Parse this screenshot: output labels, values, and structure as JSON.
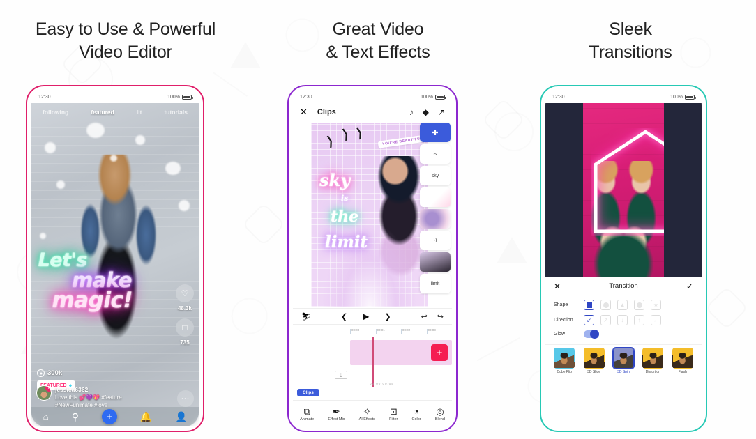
{
  "panels": [
    {
      "heading_line1": "Easy to Use & Powerful",
      "heading_line2": "Video Editor",
      "frame_color": "#e01f6a"
    },
    {
      "heading_line1": "Great Video",
      "heading_line2": "& Text Effects",
      "frame_color": "#8c27cf"
    },
    {
      "heading_line1": "Sleek",
      "heading_line2": "Transitions",
      "frame_color": "#27c9b5"
    }
  ],
  "status_bar": {
    "time": "12:30",
    "battery": "100%"
  },
  "phone1": {
    "tabs": [
      {
        "label": "following",
        "active": false
      },
      {
        "label": "featured",
        "active": true
      },
      {
        "label": "lit",
        "active": false
      },
      {
        "label": "tutorials",
        "active": false
      }
    ],
    "neon_text": {
      "line1": "Let's",
      "line2": "make",
      "line3": "magic!"
    },
    "like_count": "48.3k",
    "comment_count": "735",
    "view_count": "300k",
    "featured_badge": "FEATURED",
    "gem_icon": "gem-icon",
    "comment": {
      "username": "jessica6362",
      "line1": "Love this 💕💜💖 #feature",
      "line2": "#NewFunimate #love"
    },
    "more_icon": "ellipsis-icon",
    "nav": [
      {
        "icon": "home-icon",
        "glyph": "⌂"
      },
      {
        "icon": "search-icon",
        "glyph": "⌕"
      },
      {
        "icon": "plus-icon",
        "glyph": "+"
      },
      {
        "icon": "bell-icon",
        "glyph": "☲"
      },
      {
        "icon": "profile-icon",
        "glyph": "●"
      }
    ]
  },
  "phone2": {
    "header": {
      "close_icon": "close-icon",
      "title": "Clips",
      "music_icon": "music-note-icon",
      "layers_icon": "layers-icon",
      "export_icon": "export-icon"
    },
    "canvas": {
      "sticker_text": "YOU'RE BEAUTIFUL",
      "text1": "sky",
      "text2": "is",
      "text3": "the",
      "text4": "limit"
    },
    "layers": [
      {
        "name": "add-layer",
        "label": "+"
      },
      {
        "name": "layer-text-is",
        "label": "is"
      },
      {
        "name": "layer-text-sky",
        "label": "sky"
      },
      {
        "name": "layer-sticker",
        "label": ""
      },
      {
        "name": "layer-sparkle",
        "label": ""
      },
      {
        "name": "layer-scribble",
        "label": ""
      },
      {
        "name": "layer-model",
        "label": ""
      },
      {
        "name": "layer-limit",
        "label": "limit"
      }
    ],
    "controls": {
      "fullscreen_icon": "fullscreen-icon",
      "prev_icon": "previous-icon",
      "play_icon": "play-icon",
      "next_icon": "next-icon",
      "undo_icon": "undo-icon",
      "redo_icon": "redo-icon"
    },
    "timeline": {
      "ticks": [
        "00:00",
        "00:01",
        "00:02",
        "00:03"
      ],
      "add_clip_label": "+",
      "time_display": "00:00  00:05",
      "clips_chip": "Clips"
    },
    "tools": [
      {
        "label": "Animate",
        "icon": "animate-icon",
        "glyph": "⧉"
      },
      {
        "label": "Effect Mix",
        "icon": "effect-mix-icon",
        "glyph": "✒"
      },
      {
        "label": "AI Effects",
        "icon": "ai-effects-icon",
        "glyph": "✨"
      },
      {
        "label": "Filter",
        "icon": "filter-icon",
        "glyph": "⊡"
      },
      {
        "label": "Color",
        "icon": "color-icon",
        "glyph": "◔"
      },
      {
        "label": "Blend",
        "icon": "blend-icon",
        "glyph": "◎"
      }
    ]
  },
  "phone3": {
    "panel_header": {
      "close_icon": "close-icon",
      "title": "Transition",
      "confirm_icon": "checkmark-icon"
    },
    "rows": [
      {
        "label": "Shape",
        "options": [
          {
            "name": "shape-square",
            "selected": true
          },
          {
            "name": "shape-circle",
            "selected": false
          },
          {
            "name": "shape-triangle",
            "selected": false
          },
          {
            "name": "shape-dot",
            "selected": false
          },
          {
            "name": "shape-star",
            "selected": false
          }
        ]
      },
      {
        "label": "Direction",
        "options": [
          {
            "name": "direction-down-left",
            "selected": true,
            "glyph": "↙"
          },
          {
            "name": "direction-up-right",
            "selected": false,
            "glyph": "↗"
          },
          {
            "name": "direction-down",
            "selected": false,
            "glyph": "↓"
          },
          {
            "name": "direction-up",
            "selected": false,
            "glyph": "↑"
          },
          {
            "name": "direction-left",
            "selected": false,
            "glyph": "←"
          }
        ]
      }
    ],
    "glow": {
      "label": "Glow",
      "on": true
    },
    "presets": [
      {
        "label": "Cube Flip",
        "selected": false
      },
      {
        "label": "3D Slide",
        "selected": false
      },
      {
        "label": "3D Spin",
        "selected": true
      },
      {
        "label": "Distortion",
        "selected": false
      },
      {
        "label": "Flash",
        "selected": false
      }
    ]
  }
}
